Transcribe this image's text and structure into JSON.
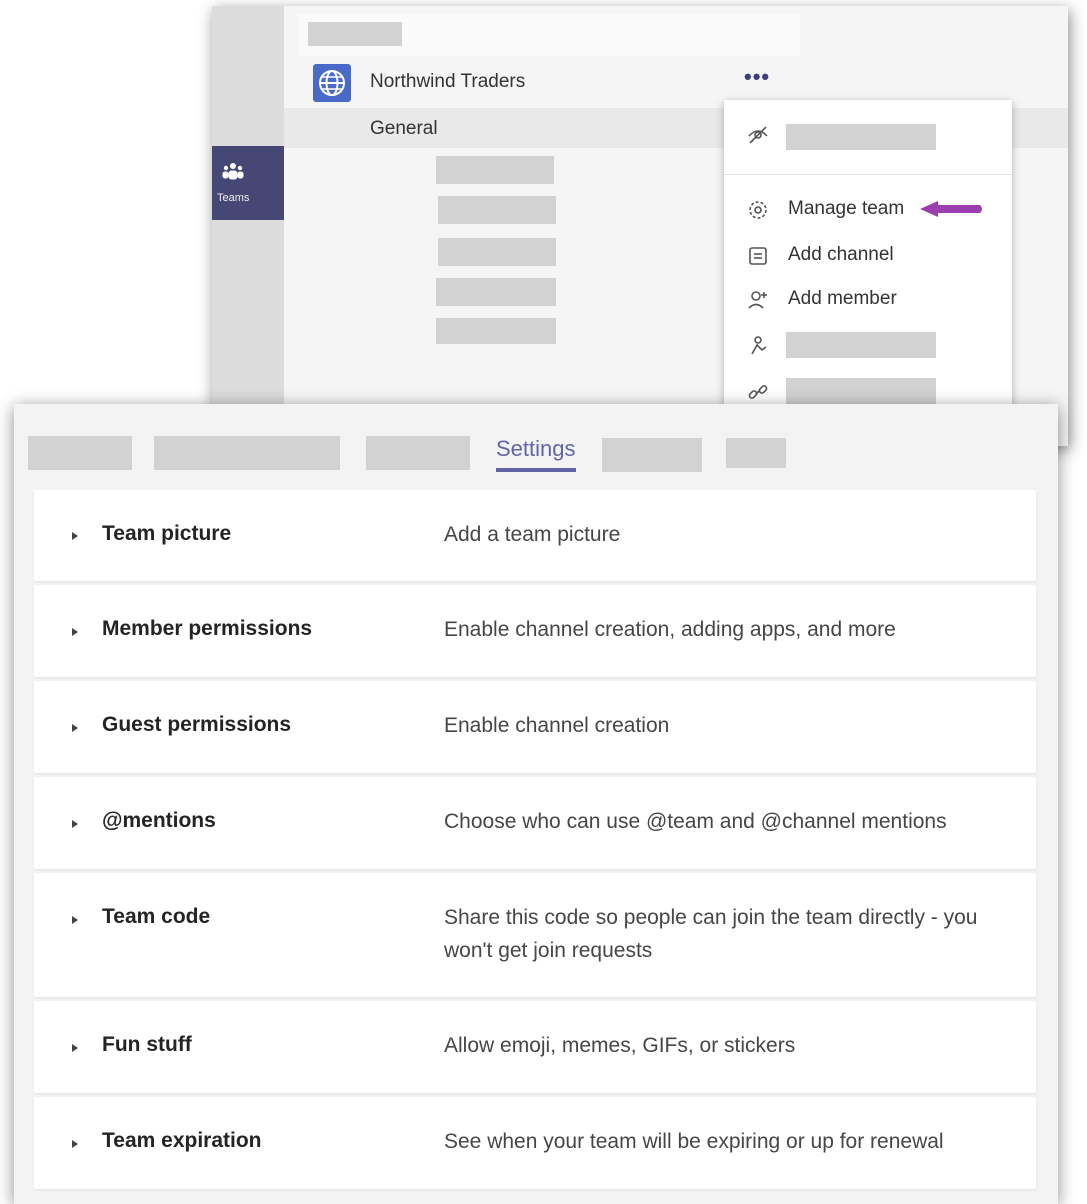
{
  "rail": {
    "teams_label": "Teams"
  },
  "team": {
    "name": "Northwind Traders",
    "more_label": "•••",
    "general": "General"
  },
  "menu": {
    "items": [
      {
        "label": "Manage team",
        "icon": "gear-icon"
      },
      {
        "label": "Add channel",
        "icon": "channel-icon"
      },
      {
        "label": "Add member",
        "icon": "add-member-icon"
      }
    ],
    "arrow_color": "#9b3fb0"
  },
  "tabs": {
    "active": "Settings"
  },
  "settings": [
    {
      "title": "Team picture",
      "desc": "Add a team picture"
    },
    {
      "title": "Member permissions",
      "desc": "Enable channel creation, adding apps, and more"
    },
    {
      "title": "Guest permissions",
      "desc": "Enable channel creation"
    },
    {
      "title": "@mentions",
      "desc": "Choose who can use @team and @channel mentions"
    },
    {
      "title": "Team code",
      "desc": "Share this code so people can join the team directly - you won't get join requests"
    },
    {
      "title": "Fun stuff",
      "desc": "Allow emoji, memes, GIFs, or stickers"
    },
    {
      "title": "Team expiration",
      "desc": "See when your team will be expiring or up for renewal"
    }
  ],
  "colors": {
    "brand": "#6264a7",
    "rail_active": "#464775",
    "team_avatar": "#4a6ac9"
  }
}
